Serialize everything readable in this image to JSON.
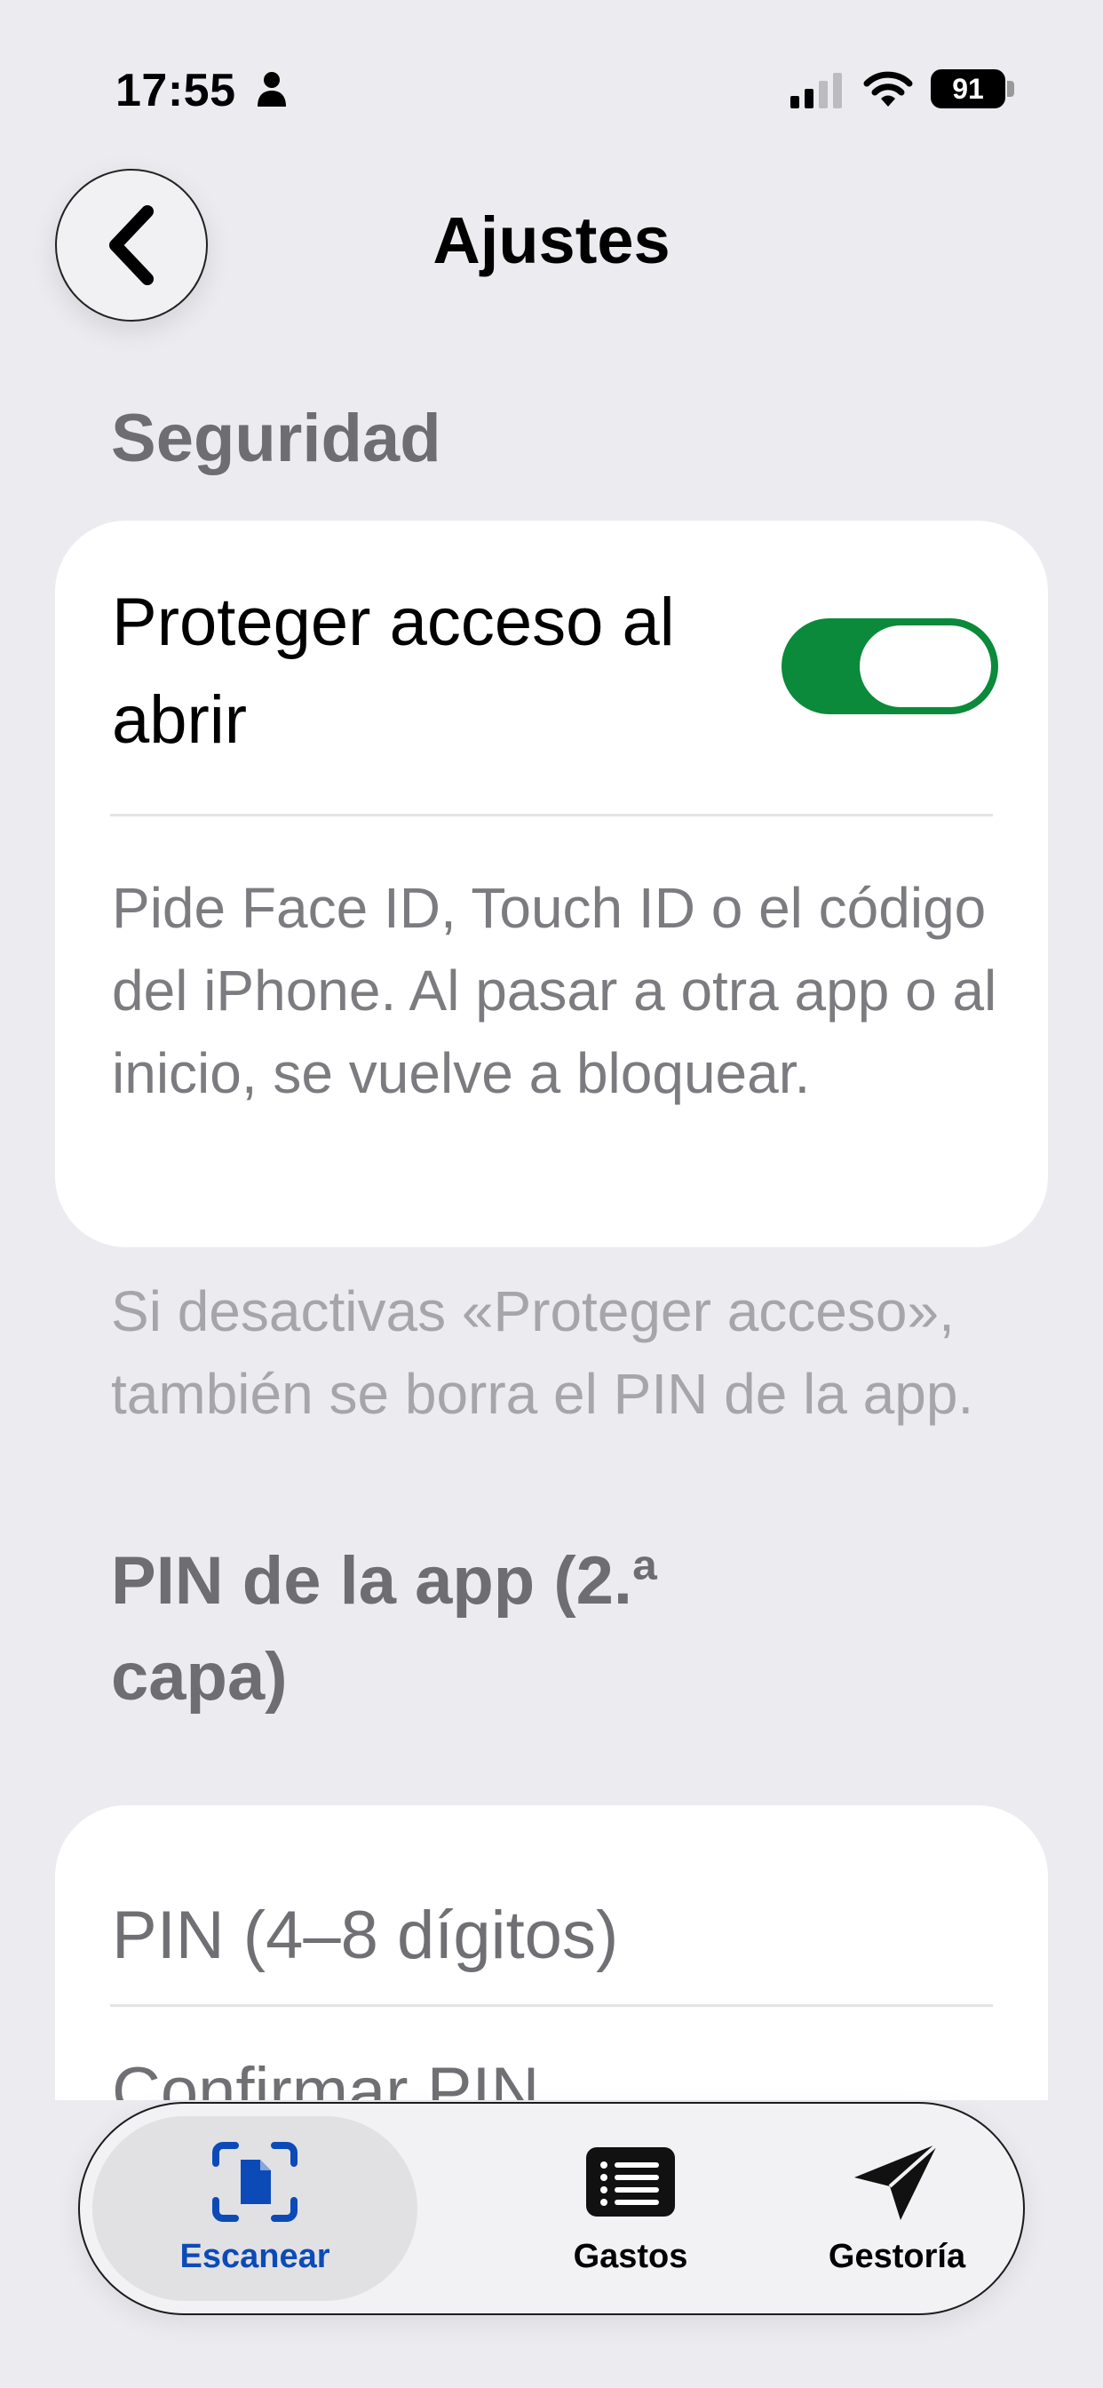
{
  "status_bar": {
    "time": "17:55",
    "battery": "91"
  },
  "header": {
    "title": "Ajustes"
  },
  "security": {
    "heading": "Seguridad",
    "toggle_label": "Proteger acceso al abrir",
    "toggle_on": true,
    "description": "Pide Face ID, Touch ID o el código del iPhone. Al pasar a otra app o al inicio, se vuelve a bloquear.",
    "footnote": "Si desactivas «Proteger acceso», también se borra el PIN de la app."
  },
  "pin_section": {
    "heading": "PIN de la app (2.ª capa)",
    "pin_placeholder": "PIN (4–8 dígitos)",
    "confirm_placeholder": "Confirmar PIN"
  },
  "tabs": [
    {
      "label": "Escanear",
      "icon": "scan-document-icon",
      "active": true
    },
    {
      "label": "Gastos",
      "icon": "list-icon",
      "active": false
    },
    {
      "label": "Gestoría",
      "icon": "paper-plane-icon",
      "active": false
    }
  ],
  "colors": {
    "accent": "#0c4bb7",
    "toggle_on": "#0a8a3a",
    "background": "#ebebf0"
  }
}
